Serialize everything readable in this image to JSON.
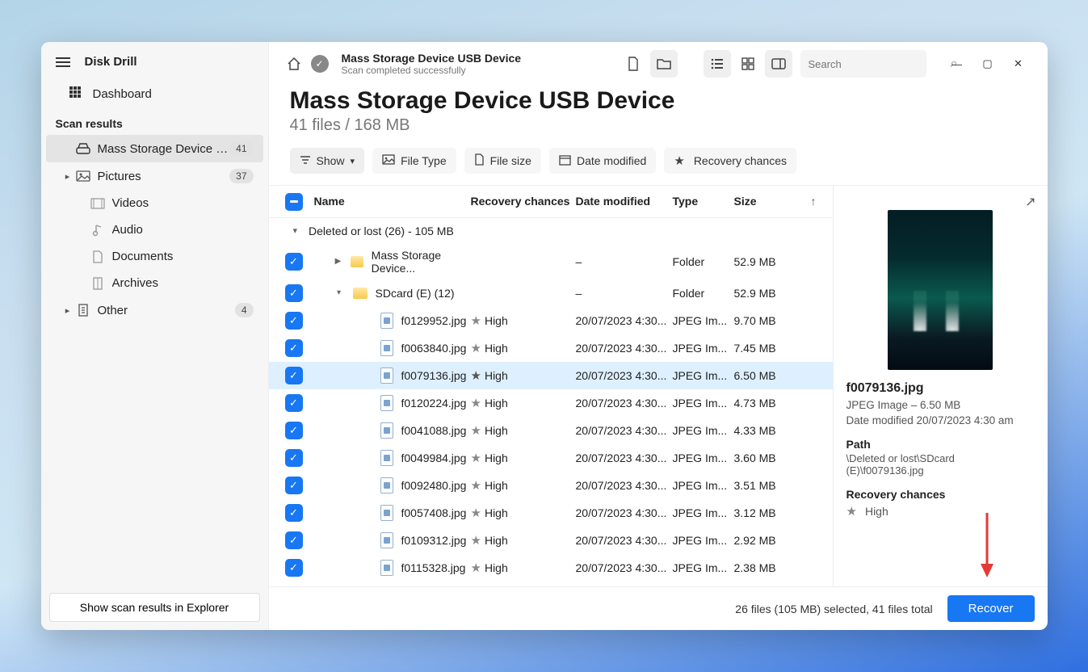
{
  "app": {
    "title": "Disk Drill"
  },
  "sidebar": {
    "dashboard": "Dashboard",
    "section": "Scan results",
    "device": {
      "label": "Mass Storage Device USB...",
      "count": "41"
    },
    "pictures": {
      "label": "Pictures",
      "count": "37"
    },
    "videos": "Videos",
    "audio": "Audio",
    "documents": "Documents",
    "archives": "Archives",
    "other": {
      "label": "Other",
      "count": "4"
    },
    "footer_btn": "Show scan results in Explorer"
  },
  "topbar": {
    "crumb_title": "Mass Storage Device USB Device",
    "crumb_sub": "Scan completed successfully",
    "search_placeholder": "Search"
  },
  "heading": {
    "title": "Mass Storage Device USB Device",
    "sub": "41 files / 168 MB"
  },
  "filters": {
    "show": "Show",
    "file_type": "File Type",
    "file_size": "File size",
    "date_modified": "Date modified",
    "recovery_chances": "Recovery chances"
  },
  "columns": {
    "name": "Name",
    "recovery": "Recovery chances",
    "date": "Date modified",
    "type": "Type",
    "size": "Size"
  },
  "group": {
    "label": "Deleted or lost (26) - 105 MB"
  },
  "rows": [
    {
      "kind": "folder",
      "indent": 1,
      "caret": "▶",
      "name": "Mass Storage Device...",
      "rec": "",
      "date": "–",
      "type": "Folder",
      "size": "52.9 MB",
      "sel": false
    },
    {
      "kind": "folder",
      "indent": 1,
      "caret": "▾",
      "name": "SDcard (E) (12)",
      "rec": "",
      "date": "–",
      "type": "Folder",
      "size": "52.9 MB",
      "sel": false
    },
    {
      "kind": "file",
      "indent": 2,
      "name": "f0129952.jpg",
      "rec": "High",
      "date": "20/07/2023 4:30...",
      "type": "JPEG Im...",
      "size": "9.70 MB",
      "sel": false
    },
    {
      "kind": "file",
      "indent": 2,
      "name": "f0063840.jpg",
      "rec": "High",
      "date": "20/07/2023 4:30...",
      "type": "JPEG Im...",
      "size": "7.45 MB",
      "sel": false
    },
    {
      "kind": "file",
      "indent": 2,
      "name": "f0079136.jpg",
      "rec": "High",
      "date": "20/07/2023 4:30...",
      "type": "JPEG Im...",
      "size": "6.50 MB",
      "sel": true
    },
    {
      "kind": "file",
      "indent": 2,
      "name": "f0120224.jpg",
      "rec": "High",
      "date": "20/07/2023 4:30...",
      "type": "JPEG Im...",
      "size": "4.73 MB",
      "sel": false
    },
    {
      "kind": "file",
      "indent": 2,
      "name": "f0041088.jpg",
      "rec": "High",
      "date": "20/07/2023 4:30...",
      "type": "JPEG Im...",
      "size": "4.33 MB",
      "sel": false
    },
    {
      "kind": "file",
      "indent": 2,
      "name": "f0049984.jpg",
      "rec": "High",
      "date": "20/07/2023 4:30...",
      "type": "JPEG Im...",
      "size": "3.60 MB",
      "sel": false
    },
    {
      "kind": "file",
      "indent": 2,
      "name": "f0092480.jpg",
      "rec": "High",
      "date": "20/07/2023 4:30...",
      "type": "JPEG Im...",
      "size": "3.51 MB",
      "sel": false
    },
    {
      "kind": "file",
      "indent": 2,
      "name": "f0057408.jpg",
      "rec": "High",
      "date": "20/07/2023 4:30...",
      "type": "JPEG Im...",
      "size": "3.12 MB",
      "sel": false
    },
    {
      "kind": "file",
      "indent": 2,
      "name": "f0109312.jpg",
      "rec": "High",
      "date": "20/07/2023 4:30...",
      "type": "JPEG Im...",
      "size": "2.92 MB",
      "sel": false
    },
    {
      "kind": "file",
      "indent": 2,
      "name": "f0115328.jpg",
      "rec": "High",
      "date": "20/07/2023 4:30...",
      "type": "JPEG Im...",
      "size": "2.38 MB",
      "sel": false
    }
  ],
  "detail": {
    "filename": "f0079136.jpg",
    "meta_type_size": "JPEG Image – 6.50 MB",
    "meta_date": "Date modified 20/07/2023 4:30 am",
    "path_label": "Path",
    "path_value": "\\Deleted or lost\\SDcard (E)\\f0079136.jpg",
    "rc_label": "Recovery chances",
    "rc_value": "High"
  },
  "footer": {
    "summary": "26 files (105 MB) selected, 41 files total",
    "recover": "Recover"
  }
}
